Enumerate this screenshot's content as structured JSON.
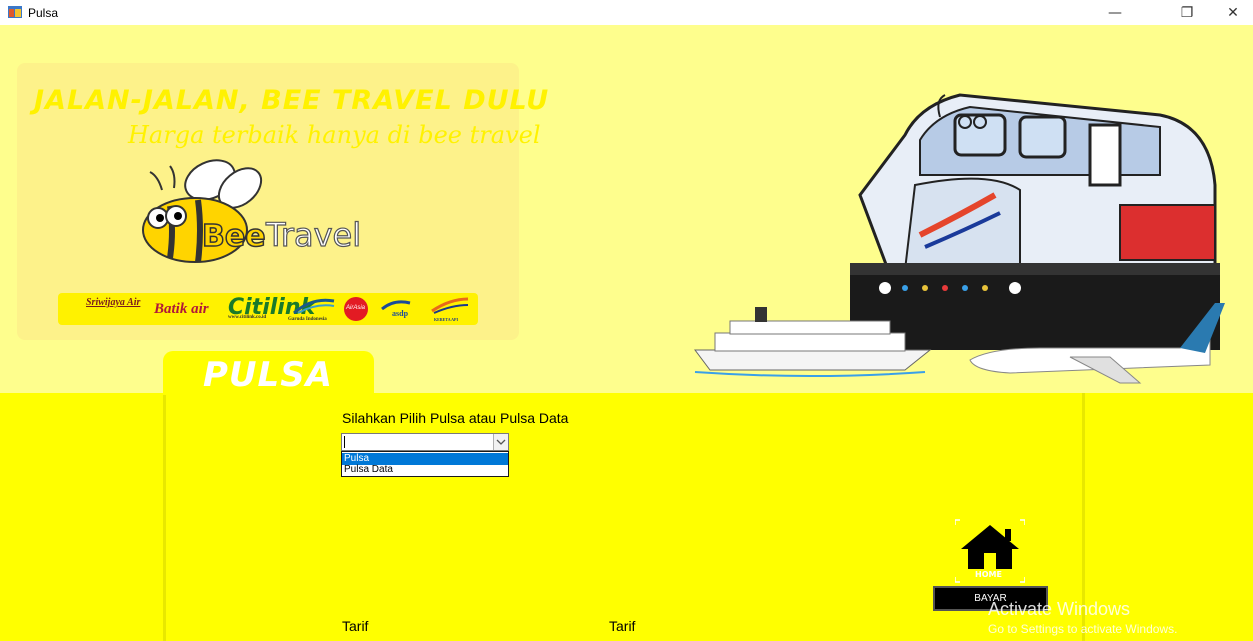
{
  "window": {
    "title": "Pulsa",
    "minimize": "—",
    "restore": "❐",
    "close": "✕"
  },
  "banner": {
    "slogan_line1": "JALAN-JALAN, BEE TRAVEL DULU",
    "slogan_line2": "Harga terbaik hanya di bee travel",
    "logo_bee": "Bee",
    "logo_travel": "Travel",
    "partners": {
      "sriwijaya": "Sriwijaya Air",
      "batik": "Batik air",
      "citilink": "Citilink",
      "citilink_url": "www.citilink.co.id",
      "garuda": "Garuda Indonesia",
      "airasia": "AirAsia",
      "asdp": "asdp",
      "kai": "KERETA API"
    }
  },
  "section": {
    "tab_label": "PULSA",
    "prompt": "Silahkan Pilih Pulsa  atau Pulsa Data",
    "combo_value": "",
    "options": [
      "Pulsa",
      "Pulsa Data"
    ],
    "selected_option": "Pulsa"
  },
  "actions": {
    "home_label": "HOME",
    "bayar_label": "BAYAR"
  },
  "labels": {
    "tarif_left": "Tarif",
    "tarif_right": "Tarif"
  },
  "watermark": {
    "line1": "Activate Windows",
    "line2": "Go to Settings to activate Windows."
  },
  "colors": {
    "background_top": "#fefe8d",
    "background_main": "#ffff00",
    "highlight": "#0078d7"
  }
}
